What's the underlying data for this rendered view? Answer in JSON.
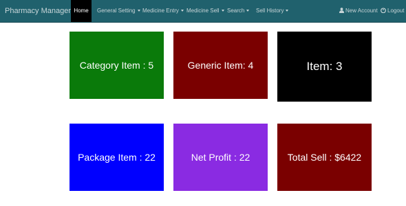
{
  "navbar": {
    "brand": "Pharmacy Management",
    "home": "Home",
    "general_setting": "General Setting",
    "medicine_entry": "Medicine Entry",
    "medicine_sell": "Medicine Sell",
    "search": "Search",
    "sell_history": "Sell History",
    "new_account": "New Account",
    "logout": "Logout"
  },
  "tiles": [
    {
      "label": "Category Item : 5",
      "color": "#0a7a0a"
    },
    {
      "label": "Generic Item: 4",
      "color": "#7a0000"
    },
    {
      "label": "Item: 3",
      "color": "#000000"
    },
    {
      "label": "Package Item : 22",
      "color": "#0000ff"
    },
    {
      "label": "Net Profit : 22",
      "color": "#8a2be2"
    },
    {
      "label": "Total Sell : $6422",
      "color": "#7a0000"
    }
  ]
}
